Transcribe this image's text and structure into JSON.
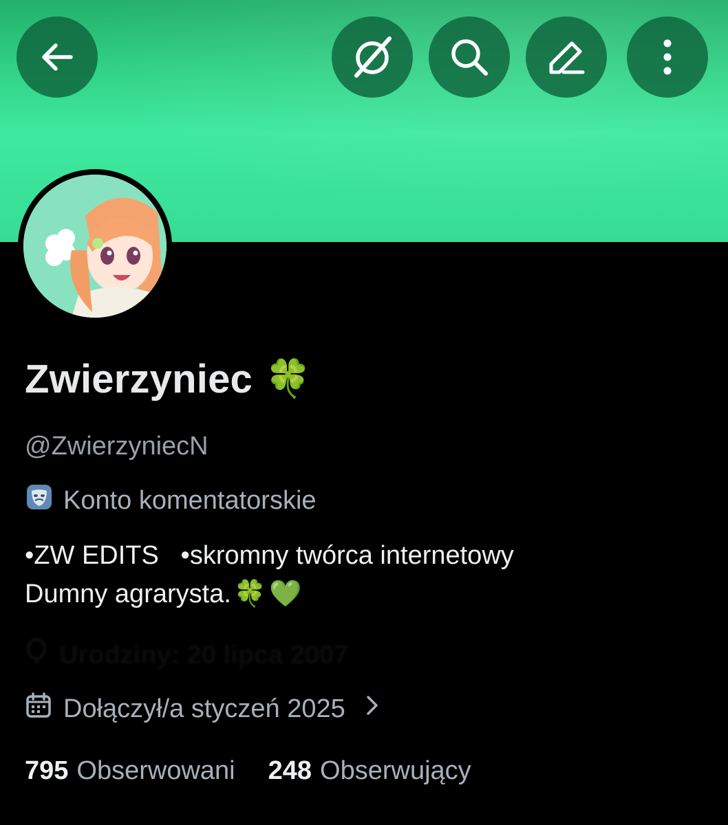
{
  "header": {
    "buttons": [
      {
        "name": "back-button",
        "icon": "arrow-left-icon"
      },
      {
        "name": "grok-button",
        "icon": "grok-icon"
      },
      {
        "name": "search-button",
        "icon": "search-icon"
      },
      {
        "name": "edit-button",
        "icon": "pencil-icon"
      },
      {
        "name": "more-button",
        "icon": "more-vertical-icon"
      }
    ],
    "banner_color": "#3fe9a0"
  },
  "profile": {
    "display_name": "Zwierzyniec",
    "name_emoji": "🍀",
    "handle": "@ZwierzyniecN",
    "label_icon": "theater-masks-icon",
    "label": "Konto komentatorskie",
    "bio_line_1": "•ZW EDITS   •skromny twórca internetowy",
    "bio_line_2": "Dumny agrarysta.",
    "bio_emoji_1": "🍀",
    "bio_emoji_2": "💚",
    "birthday": "Urodziny: 20 lipca 2007",
    "joined": "Dołączył/a styczeń 2025",
    "following_count": "795",
    "following_label": "Obserwowani",
    "followers_count": "248",
    "followers_label": "Obserwujący"
  }
}
